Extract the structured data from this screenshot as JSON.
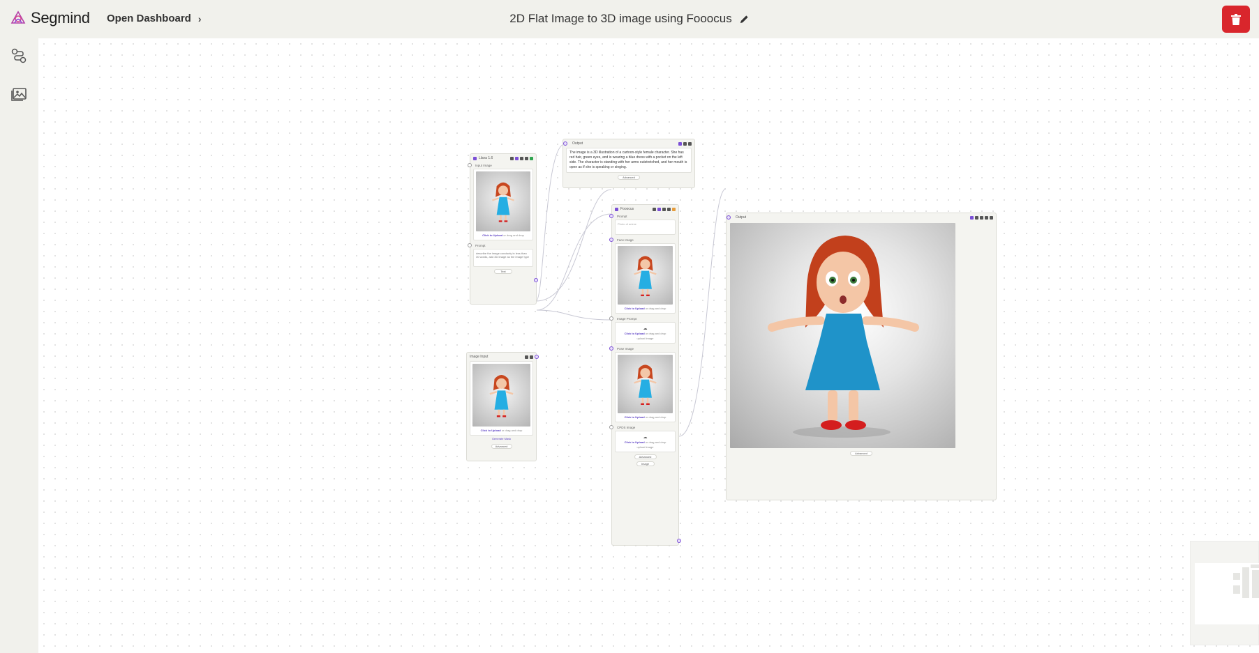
{
  "app": {
    "brand": "Segmind",
    "open_dashboard": "Open Dashboard",
    "workflow_title": "2D Flat Image to 3D image using Fooocus",
    "accent": "#7b4fd6",
    "delete_color": "#d9262c"
  },
  "sidebar": {
    "items": [
      {
        "icon": "workflow-icon"
      },
      {
        "icon": "gallery-icon"
      }
    ]
  },
  "nodes": {
    "llava": {
      "title": "Llava 1.6",
      "field_input": "Input Image",
      "field_prompt": "Prompt",
      "upload_click": "Click to Upload",
      "upload_rest": " or drag and drop",
      "prompt_value": "describe the image concisely in less than 30 words, add 3D image as the image type",
      "output_type": "Text"
    },
    "output_text": {
      "title": "Output",
      "text": "The image is a 3D illustration of a cartoon-style female character. She has red hair, green eyes, and is wearing a blue dress with a pocket on the left side. The character is standing with her arms outstretched, and her mouth is open as if she is speaking or singing.",
      "advanced": "Advanced"
    },
    "image_input": {
      "title": "Image Input",
      "upload_click": "Click to Upload",
      "upload_rest": " or drag and drop",
      "generate_mask": "Generate Mask",
      "advanced": "Advanced"
    },
    "fooocus": {
      "title": "Fooocus",
      "field_prompt": "Prompt",
      "prompt_placeholder": "Photo of anime",
      "field_face": "Face Image",
      "field_image_prompt": "Image Prompt",
      "field_pose": "Pose Image",
      "field_cpds": "CPDS Image",
      "upload_click": "Click to Upload",
      "upload_rest": " or drag and drop",
      "upload_sub": "upload image",
      "advanced": "Advanced",
      "output_type": "Image"
    },
    "output_image": {
      "title": "Output",
      "advanced": "Advanced"
    }
  }
}
